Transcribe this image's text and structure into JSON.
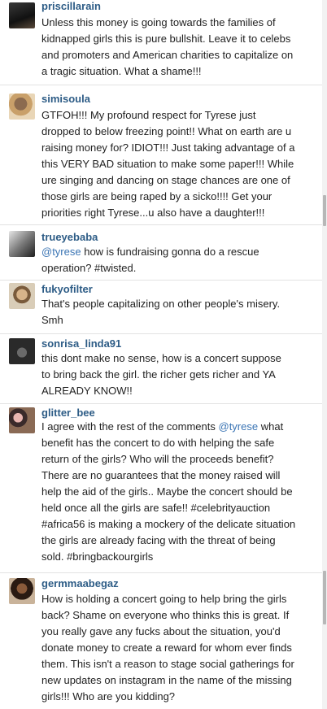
{
  "comments": [
    {
      "username": "priscillarain",
      "text": "Unless this money is going towards the families of\nkidnapped girls this is pure bullshit. Leave it to celebs\nand promoters and American charities to capitalize on\na tragic situation. What a shame!!!"
    },
    {
      "username": "simisoula",
      "text": "GTFOH!!! My profound respect for Tyrese just\ndropped to below freezing point!! What on earth are u\nraising money for? IDIOT!!! Just taking advantage of a\nthis VERY BAD situation to make some paper!!! While\nure singing and dancing on stage chances are one of\nthose girls are being raped by a sicko!!!! Get your\npriorities right Tyrese...u also have a daughter!!!"
    },
    {
      "username": "trueyebaba",
      "mention": "@tyrese",
      "text": " how is fundraising gonna do a rescue\noperation? #twisted."
    },
    {
      "username": "fukyofilter",
      "text": "That's people capitalizing on other people's misery.\nSmh"
    },
    {
      "username": "sonrisa_linda91",
      "text": "this dont make no sense, how is a concert suppose\nto bring back the girl. the richer gets richer and YA\nALREADY KNOW!!"
    },
    {
      "username": "glitter_bee",
      "text_before": "I agree with the rest of the comments ",
      "mention": "@tyrese",
      "text": " what\nbenefit has the concert to do with helping the safe\nreturn of the girls? Who will the proceeds benefit?\nThere are no guarantees that the money raised will\nhelp the aid of the girls.. Maybe the concert should be\nheld once all the girls are safe!! #celebrityauction\n#africa56 is making a mockery of the delicate situation\nthe girls are already facing with the threat of being\nsold. #bringbackourgirls"
    },
    {
      "username": "germmaabegaz",
      "text": "How is holding a concert going to help bring the girls\nback? Shame on everyone who thinks this is great. If\nyou really gave any fucks about the situation, you'd\ndonate money to create a reward for whom ever finds\nthem. This isn't a reason to stage social gatherings for\nnew updates on instagram in the name of the missing\ngirls!!! Who are you kidding?"
    }
  ],
  "colors": {
    "username": "#2d5c86",
    "mention": "#3a74b4",
    "text": "#222222",
    "separator": "#e2e2e2"
  },
  "icons": [
    "user-avatar"
  ]
}
